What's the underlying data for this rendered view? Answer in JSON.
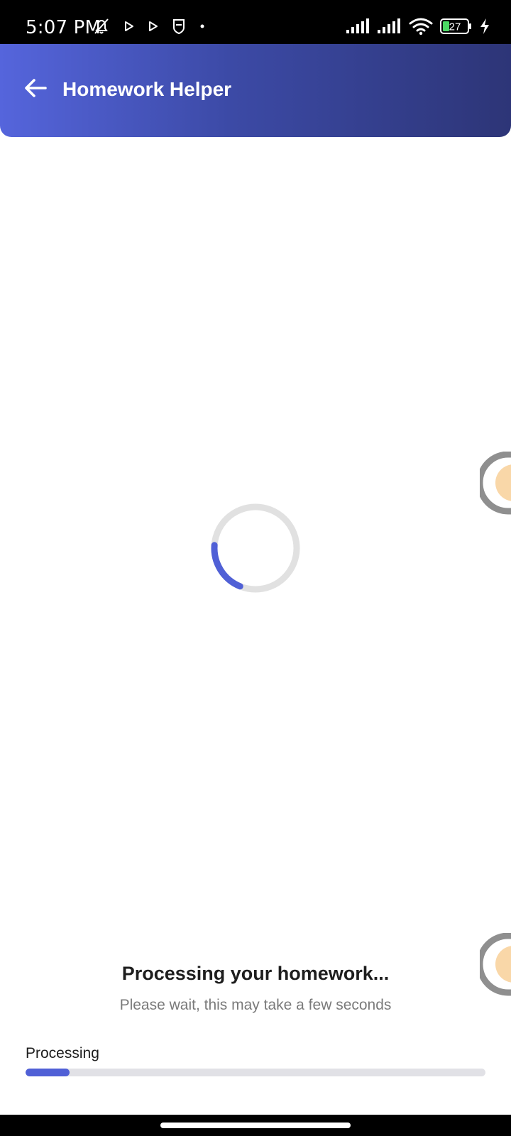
{
  "status_bar": {
    "time": "5:07 PM",
    "battery_level": "27",
    "icons": [
      "mute-bell-icon",
      "play-icon",
      "play-icon",
      "shield-icon",
      "dot-icon",
      "signal-icon",
      "signal-icon",
      "wifi-icon",
      "battery-icon",
      "charging-icon"
    ]
  },
  "header": {
    "title": "Homework Helper",
    "back_icon": "arrow-left-icon",
    "gradient": [
      "#5565dc",
      "#2d3577"
    ]
  },
  "loading": {
    "spinner_color": "#5060d6",
    "spinner_track_color": "#e1e1e1",
    "title": "Processing your homework...",
    "subtitle": "Please wait, this may take a few seconds"
  },
  "progress": {
    "label": "Processing",
    "fraction": 0.095,
    "color": "#5060d6"
  }
}
